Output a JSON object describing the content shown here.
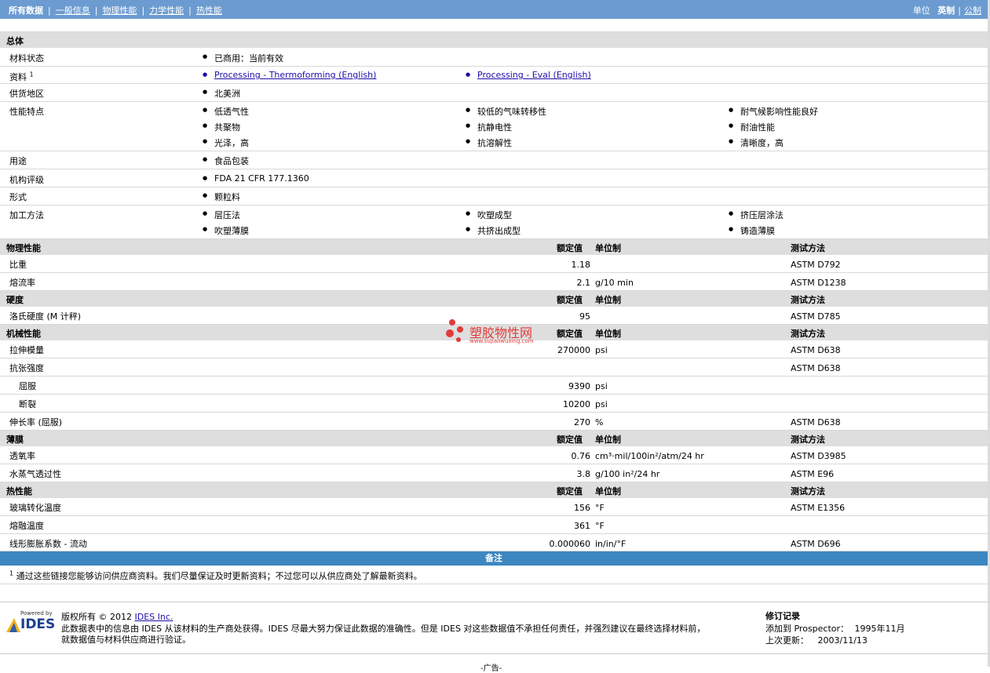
{
  "nav": {
    "items": [
      "所有数据",
      "一般信息",
      "物理性能",
      "力学性能",
      "热性能"
    ],
    "unit_label": "单位",
    "unit_english": "英制",
    "unit_metric": "公制"
  },
  "general": {
    "title": "总体",
    "material_status_label": "材料状态",
    "material_status": "已商用：当前有效",
    "docs_label": "资料",
    "docs_sup": "1",
    "doc_links": [
      "Processing - Thermoforming (English)",
      "Processing - Eval (English)"
    ],
    "region_label": "供货地区",
    "region": "北美洲",
    "features_label": "性能特点",
    "features": [
      "低透气性",
      "较低的气味转移性",
      "耐气候影响性能良好",
      "共聚物",
      "抗静电性",
      "耐油性能",
      "光泽，高",
      "抗溶解性",
      "清晰度，高"
    ],
    "uses_label": "用途",
    "uses": "食品包装",
    "agency_label": "机构评级",
    "agency": "FDA 21 CFR 177.1360",
    "form_label": "形式",
    "form": "颗粒料",
    "process_label": "加工方法",
    "process": [
      "层压法",
      "吹塑成型",
      "挤压层涂法",
      "吹塑薄膜",
      "共挤出成型",
      "铸造薄膜"
    ]
  },
  "cols": {
    "nominal": "额定值",
    "unit": "单位制",
    "method": "测试方法"
  },
  "physical": {
    "title": "物理性能",
    "rows": [
      {
        "label": "比重",
        "value": "1.18",
        "unit": "",
        "method": "ASTM D792"
      },
      {
        "label": "熔流率",
        "value": "2.1",
        "unit": "g/10 min",
        "method": "ASTM D1238"
      }
    ]
  },
  "hardness": {
    "title": "硬度",
    "rows": [
      {
        "label": "洛氏硬度 (M 计秤)",
        "value": "95",
        "unit": "",
        "method": "ASTM D785"
      }
    ]
  },
  "mechanical": {
    "title": "机械性能",
    "rows": [
      {
        "label": "拉伸模量",
        "value": "270000",
        "unit": "psi",
        "method": "ASTM D638"
      },
      {
        "label": "抗张强度",
        "value": "",
        "unit": "",
        "method": "ASTM D638"
      },
      {
        "label": "屈服",
        "value": "9390",
        "unit": "psi",
        "method": ""
      },
      {
        "label": "断裂",
        "value": "10200",
        "unit": "psi",
        "method": ""
      },
      {
        "label": "伸长率 (屈服)",
        "value": "270",
        "unit": "%",
        "method": "ASTM D638"
      }
    ]
  },
  "film": {
    "title": "薄膜",
    "rows": [
      {
        "label": "透氧率",
        "value": "0.76",
        "unit": "cm³·mil/100in²/atm/24 hr",
        "method": "ASTM D3985"
      },
      {
        "label": "水蒸气透过性",
        "value": "3.8",
        "unit": "g/100 in²/24 hr",
        "method": "ASTM E96"
      }
    ]
  },
  "thermal": {
    "title": "热性能",
    "rows": [
      {
        "label": "玻璃转化温度",
        "value": "156",
        "unit": "°F",
        "method": "ASTM E1356"
      },
      {
        "label": "熔融温度",
        "value": "361",
        "unit": "°F",
        "method": ""
      },
      {
        "label": "线形膨胀系数 - 流动",
        "value": "0.000060",
        "unit": "in/in/°F",
        "method": "ASTM D696"
      }
    ]
  },
  "notes": {
    "title": "备注",
    "sup": "1",
    "text": "通过这些链接您能够访问供应商资料。我们尽量保证及时更新资料；不过您可以从供应商处了解最新资料。"
  },
  "watermark": {
    "name": "塑胶物性网",
    "url": "www.sujiaowuxing.com"
  },
  "footer": {
    "powered_by": "Powered by",
    "logo": "IDES",
    "copyright": "版权所有 © 2012",
    "ides_link": "IDES Inc.",
    "disclaimer_1": "此数据表中的信息由  IDES 从该材料的生产商处获得。IDES 尽最大努力保证此数据的准确性。但是  IDES 对这些数据值不承担任何责任，并强烈建议在最终选择材料前，",
    "disclaimer_2": "就数据值与材料供应商进行验证。",
    "revision_title": "修订记录",
    "added_label": "添加到  Prospector：",
    "added_value": "1995年11月",
    "updated_label": "上次更新：",
    "updated_value": "2003/11/13",
    "ad": "-广告-"
  }
}
